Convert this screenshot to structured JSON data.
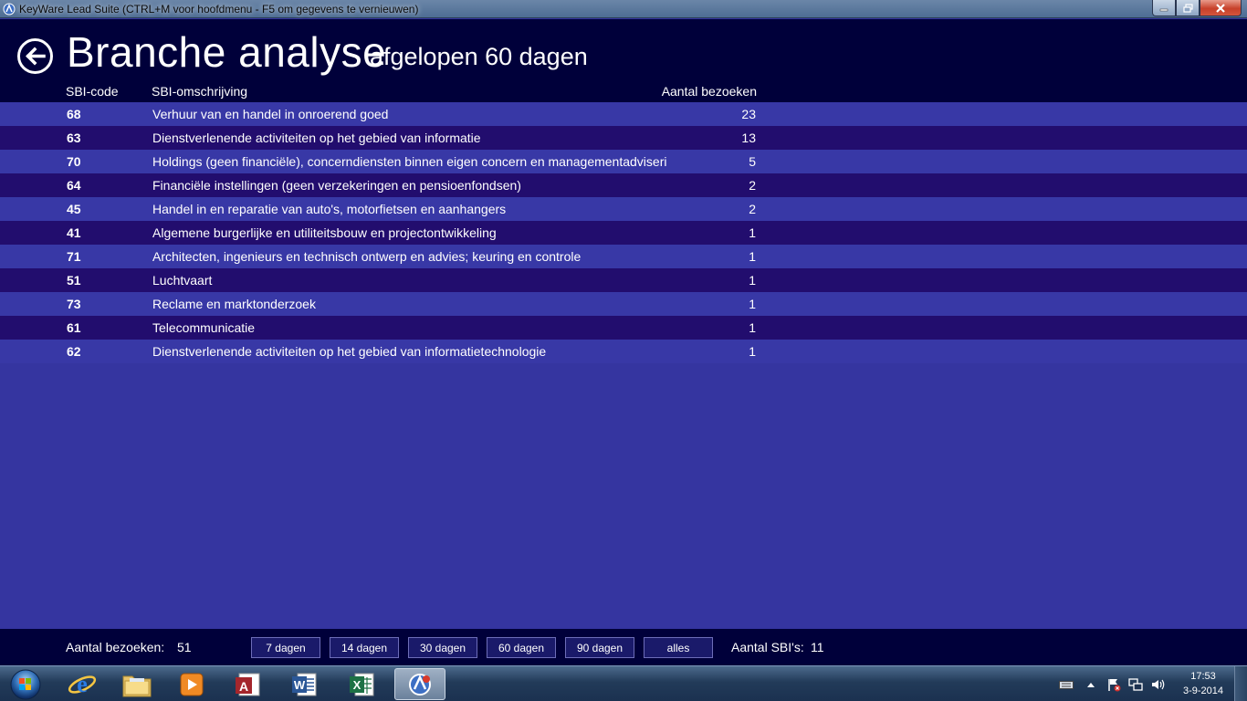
{
  "window": {
    "title": "KeyWare Lead Suite (CTRL+M voor hoofdmenu - F5 om gegevens te vernieuwen)"
  },
  "header": {
    "title": "Branche analyse",
    "subtitle": "afgelopen 60 dagen"
  },
  "columns": {
    "code": "SBI-code",
    "description": "SBI-omschrijving",
    "visits": "Aantal bezoeken"
  },
  "rows": [
    {
      "code": "68",
      "description": "Verhuur van en handel in onroerend goed",
      "visits": "23"
    },
    {
      "code": "63",
      "description": "Dienstverlenende activiteiten op het gebied van informatie",
      "visits": "13"
    },
    {
      "code": "70",
      "description": "Holdings (geen financiële), concerndiensten binnen eigen concern en managementadviseri",
      "visits": "5"
    },
    {
      "code": "64",
      "description": "Financiële instellingen (geen verzekeringen en pensioenfondsen)",
      "visits": "2"
    },
    {
      "code": "45",
      "description": "Handel in en reparatie van auto's, motorfietsen en aanhangers",
      "visits": "2"
    },
    {
      "code": "41",
      "description": "Algemene burgerlijke en utiliteitsbouw en projectontwikkeling",
      "visits": "1"
    },
    {
      "code": "71",
      "description": "Architecten, ingenieurs en technisch ontwerp en advies; keuring en controle",
      "visits": "1"
    },
    {
      "code": "51",
      "description": "Luchtvaart",
      "visits": "1"
    },
    {
      "code": "73",
      "description": "Reclame en marktonderzoek",
      "visits": "1"
    },
    {
      "code": "61",
      "description": "Telecommunicatie",
      "visits": "1"
    },
    {
      "code": "62",
      "description": "Dienstverlenende activiteiten op het gebied van informatietechnologie",
      "visits": "1"
    }
  ],
  "footer": {
    "visits_label": "Aantal bezoeken:",
    "visits_value": "51",
    "sbi_label": "Aantal SBI's:",
    "sbi_value": "11",
    "buttons": [
      "7 dagen",
      "14 dagen",
      "30 dagen",
      "60 dagen",
      "90 dagen",
      "alles"
    ]
  },
  "taskbar": {
    "apps": [
      "internet-explorer-icon",
      "file-explorer-icon",
      "media-player-icon",
      "access-icon",
      "word-icon",
      "excel-icon",
      "keyware-icon"
    ],
    "time": "17:53",
    "date": "3-9-2014"
  },
  "colors": {
    "header_bg": "#00003a",
    "row_light": "#3838a6",
    "row_dark": "#220d6e",
    "body_bg": "#3535a0"
  }
}
